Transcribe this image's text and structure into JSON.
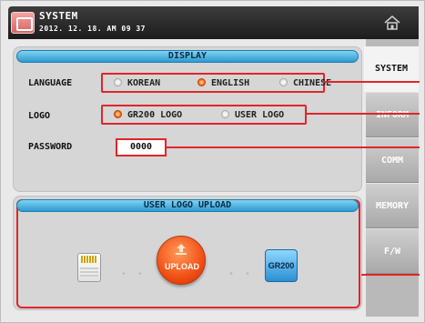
{
  "header": {
    "title": "SYSTEM",
    "datetime": "2012. 12. 18. AM 09 37"
  },
  "tabs": [
    {
      "label": "SYSTEM",
      "active": true
    },
    {
      "label": "INFORM",
      "active": false
    },
    {
      "label": "COMM",
      "active": false
    },
    {
      "label": "MEMORY",
      "active": false
    },
    {
      "label": "F/W",
      "active": false
    }
  ],
  "display": {
    "title": "DISPLAY",
    "language_label": "LANGUAGE",
    "language_options": [
      "KOREAN",
      "ENGLISH",
      "CHINESE"
    ],
    "language_selected": "ENGLISH",
    "logo_label": "LOGO",
    "logo_options": [
      "GR200 LOGO",
      "USER LOGO"
    ],
    "logo_selected": "GR200 LOGO",
    "password_label": "PASSWORD",
    "password_value": "0000"
  },
  "upload": {
    "title": "USER LOGO UPLOAD",
    "button_label": "UPLOAD",
    "chip_label": "GR200"
  },
  "colors": {
    "highlight": "#e0252b",
    "accent_bar": "#2e9ad0",
    "upload_button": "#f04a10"
  },
  "icons": [
    "system-icon",
    "home-icon",
    "sd-card-icon",
    "upload-icon",
    "gr200-icon"
  ]
}
